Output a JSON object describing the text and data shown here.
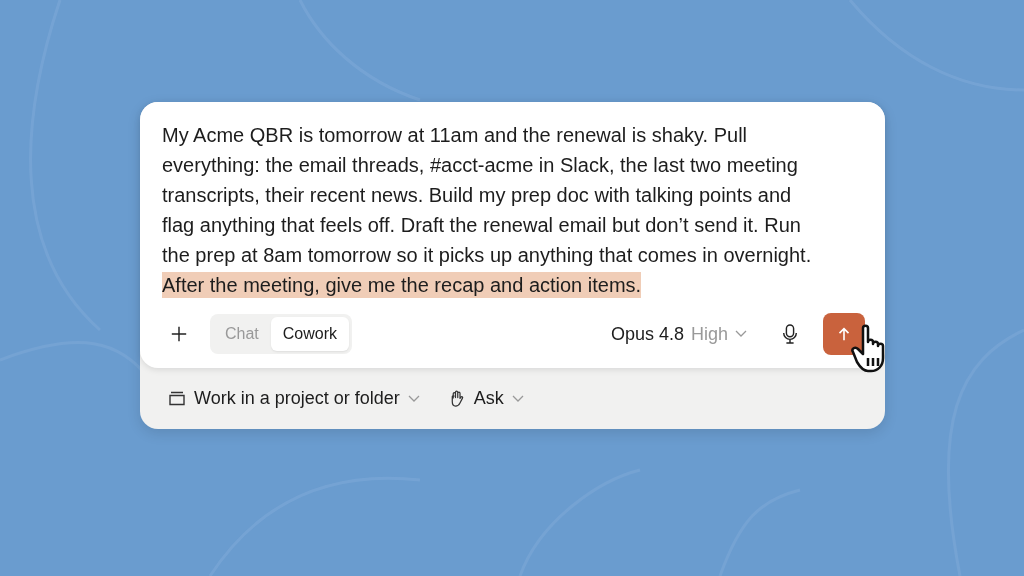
{
  "prompt": {
    "segments": [
      {
        "text": "My Acme QBR is tomorrow at 11am and the renewal is shaky. Pull everything: the email threads, #acct-acme in Slack, the last two meeting transcripts, their recent news. Build my prep doc with talking points and flag anything that feels off. Draft the renewal email but don’t send it. Run the prep at 8am tomorrow so it picks up anything that comes in overnight. ",
        "highlighted": false
      },
      {
        "text": "After the meeting, give me the recap and action items.",
        "highlighted": true
      }
    ]
  },
  "modes": [
    {
      "label": "Chat",
      "selected": false
    },
    {
      "label": "Cowork",
      "selected": true
    }
  ],
  "model": {
    "name": "Opus 4.8",
    "effort": "High"
  },
  "footer": [
    {
      "kind": "folder",
      "label": "Work in a project or folder"
    },
    {
      "kind": "hand",
      "label": "Ask"
    }
  ]
}
